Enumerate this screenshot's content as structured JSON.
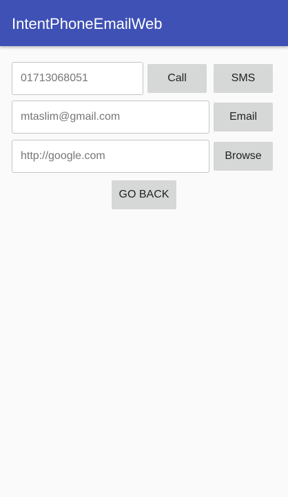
{
  "app_bar": {
    "title": "IntentPhoneEmailWeb",
    "color": "#3f51b5"
  },
  "phone_row": {
    "phone_value": "01713068051",
    "call_label": "Call",
    "sms_label": "SMS"
  },
  "email_row": {
    "email_value": "mtaslim@gmail.com",
    "email_label": "Email"
  },
  "web_row": {
    "url_value": "http://google.com",
    "browse_label": "Browse"
  },
  "go_back_label": "GO BACK"
}
